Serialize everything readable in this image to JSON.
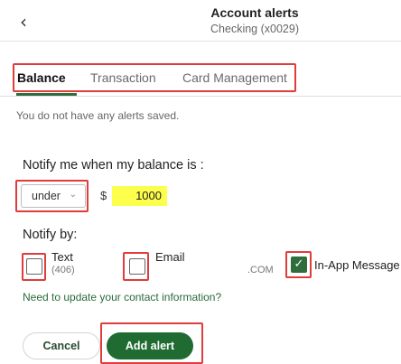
{
  "header": {
    "back_icon": "chevron-left-icon",
    "title": "Account alerts",
    "subtitle": "Checking (x0029)"
  },
  "tabs": [
    {
      "label": "Balance",
      "active": true
    },
    {
      "label": "Transaction",
      "active": false
    },
    {
      "label": "Card Management",
      "active": false
    }
  ],
  "empty_message": "You do not have any alerts saved.",
  "balance": {
    "label": "Notify me when my balance is :",
    "condition": "under",
    "currency_symbol": "$",
    "amount": "1000"
  },
  "notify_by": {
    "label": "Notify by:",
    "options": [
      {
        "label": "Text",
        "detail": "(406)",
        "checked": false
      },
      {
        "label": "Email",
        "detail": ".COM",
        "checked": false
      },
      {
        "label": "In-App Message",
        "detail": "",
        "checked": true
      }
    ]
  },
  "contact_link": "Need to update your contact information?",
  "actions": {
    "cancel_label": "Cancel",
    "add_label": "Add alert"
  },
  "colors": {
    "accent_green": "#1f6b32",
    "highlight_red": "#e03c3c",
    "amount_highlight": "#fdff4d"
  }
}
